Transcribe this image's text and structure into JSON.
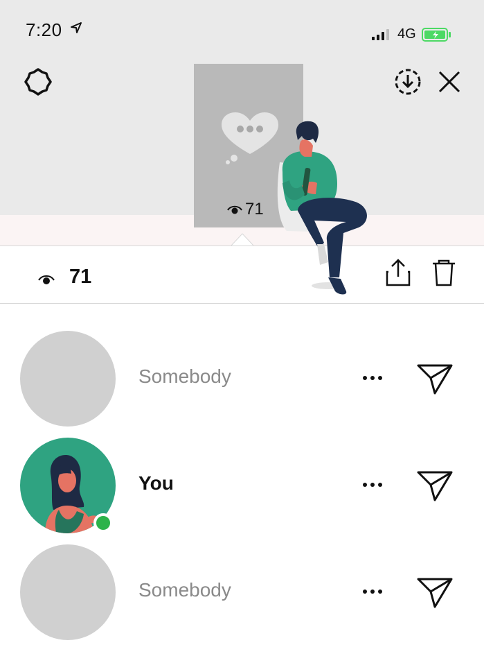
{
  "status_bar": {
    "time": "7:20",
    "network": "4G"
  },
  "story_preview": {
    "view_count": "71"
  },
  "actions_bar": {
    "view_count": "71"
  },
  "viewers": [
    {
      "name": "Somebody",
      "is_self": false
    },
    {
      "name": "You",
      "is_self": true,
      "online": true
    },
    {
      "name": "Somebody",
      "is_self": false
    }
  ],
  "colors": {
    "accent_green": "#2fa381",
    "online_green": "#2cb34a",
    "battery_green": "#4cd964"
  }
}
